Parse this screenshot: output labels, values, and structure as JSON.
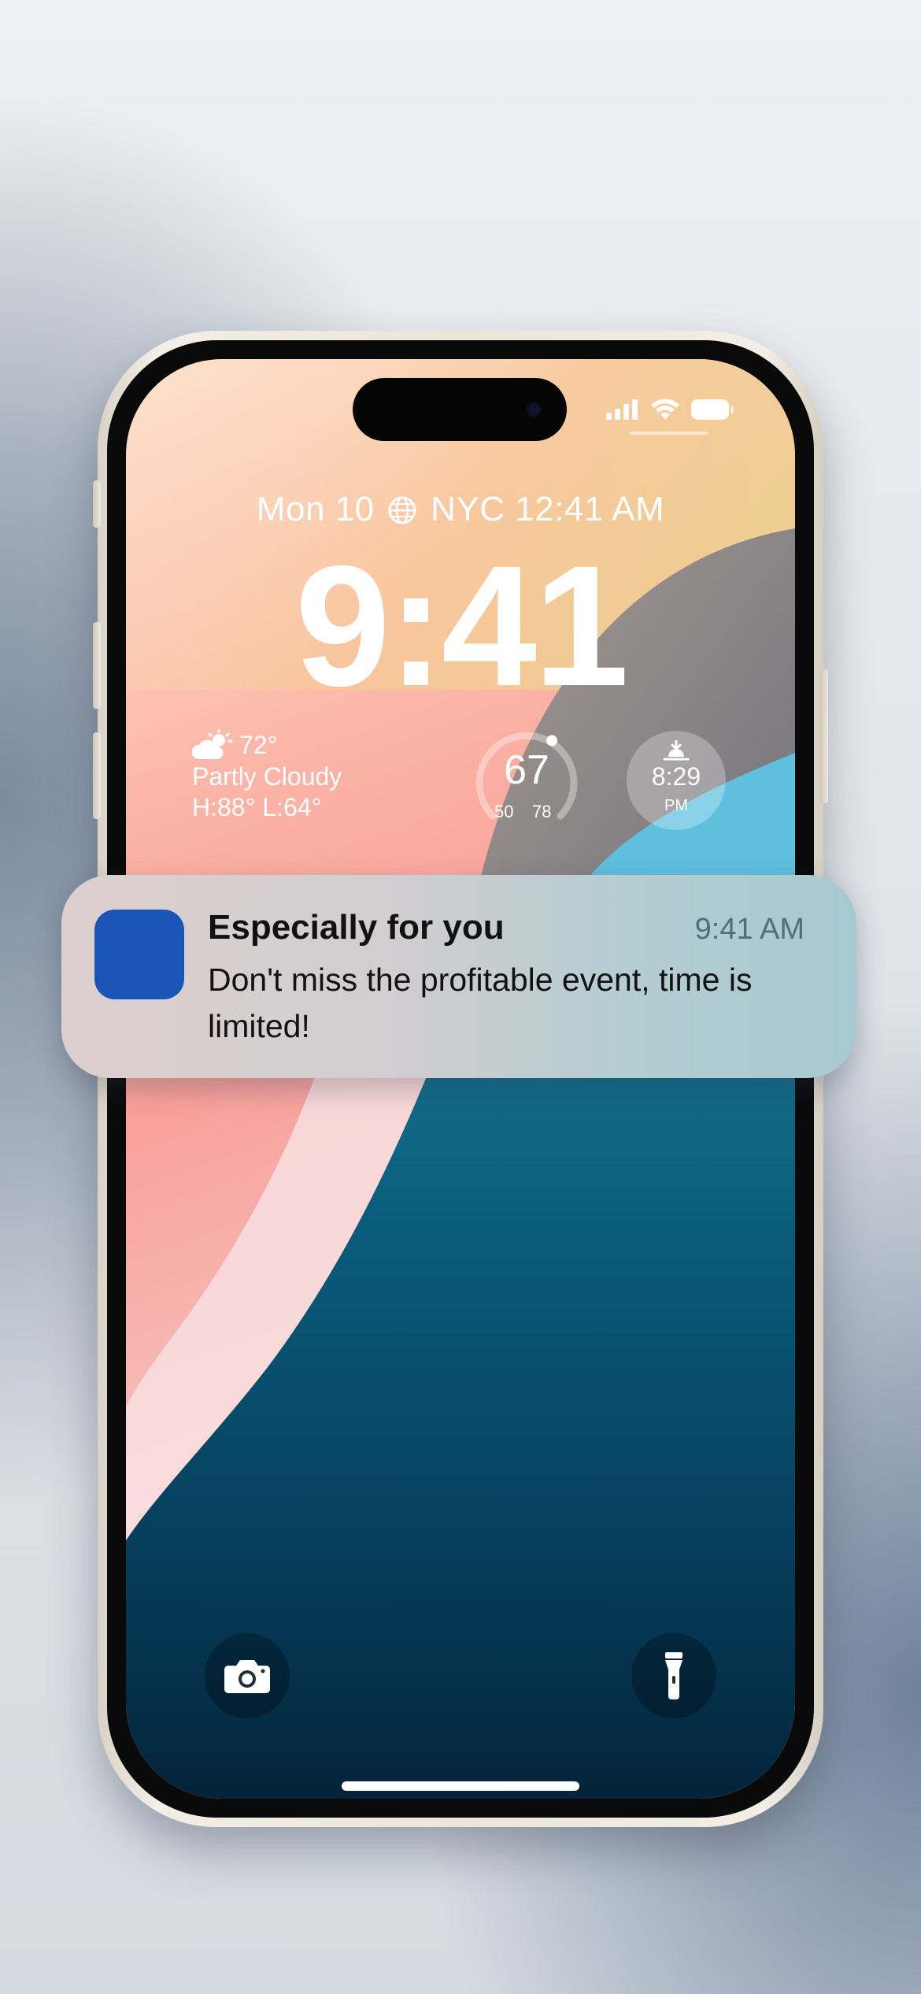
{
  "lockscreen": {
    "date_line_left": "Mon 10",
    "date_line_right": "NYC 12:41 AM",
    "time": "9:41",
    "weather": {
      "temp": "72°",
      "condition": "Partly Cloudy",
      "high_low": "H:88° L:64°",
      "icon": "partly-cloudy-icon"
    },
    "temp_gauge": {
      "value": "67",
      "low": "50",
      "high": "78",
      "level": 0.62
    },
    "sunset": {
      "time": "8:29",
      "period": "PM",
      "icon": "sunset-icon"
    },
    "status_icons": [
      "cellular-signal-icon",
      "wifi-icon",
      "battery-icon"
    ],
    "quick_actions": [
      "camera-icon",
      "flashlight-icon"
    ]
  },
  "notification": {
    "title": "Especially for you",
    "time": "9:41 AM",
    "body": "Don't miss the profitable event, time is limited!",
    "app_icon_color": "#1a54b4"
  }
}
